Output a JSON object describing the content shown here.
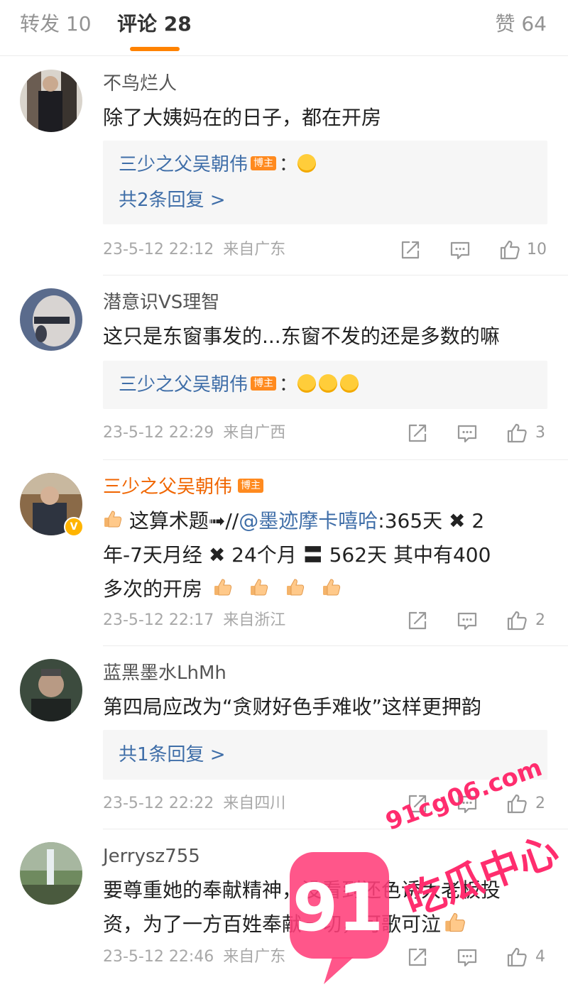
{
  "tabs": {
    "reposts": "转发 10",
    "comments": "评论 28",
    "likes": "赞 64"
  },
  "comments": [
    {
      "user": "不鸟烂人",
      "text": "除了大姨妈在的日子，都在开房",
      "reply": {
        "author": "三少之父吴朝伟",
        "badge": "博主",
        "colon": "：",
        "more": "共2条回复 >"
      },
      "time": "23-5-12 22:12",
      "location": "来自广东",
      "likes": "10"
    },
    {
      "user": "潜意识VS理智",
      "text": "这只是东窗事发的...东窗不发的还是多数的嘛",
      "reply": {
        "author": "三少之父吴朝伟",
        "badge": "博主",
        "colon": "："
      },
      "time": "23-5-12 22:29",
      "location": "来自广西",
      "likes": "3"
    },
    {
      "user": "三少之父吴朝伟",
      "badge": "博主",
      "text_parts": {
        "before": "这算术题➟//",
        "mention": "@墨迹摩卡嘻哈",
        "line1_end": ":365天 ✖ 2",
        "line2": "年-7天月经 ✖ 24个月 〓 562天  其中有400",
        "line3": "多次的开房"
      },
      "time": "23-5-12 22:17",
      "location": "来自浙江",
      "likes": "2"
    },
    {
      "user": "蓝黑墨水LhMh",
      "text": "第四局应改为“贪财好色手难收”这样更押韵",
      "reply": {
        "more": "共1条回复 >"
      },
      "time": "23-5-12 22:22",
      "location": "来自四川",
      "likes": "2"
    },
    {
      "user": "Jerrysz755",
      "text_line1": "要尊重她的奉献精神，没看到还色诱大老板投",
      "text_line2": "资，为了一方百姓奉献一切，可歌可泣",
      "time": "23-5-12 22:46",
      "location": "来自广东",
      "likes": "4"
    }
  ],
  "watermark": {
    "url": "91cg06.com",
    "name": "吃瓜中心",
    "logo": "91"
  },
  "colors": {
    "accent": "#ff8200",
    "link": "#3f6ea8",
    "host_name": "#f06500",
    "watermark": "#ff2d6e"
  }
}
